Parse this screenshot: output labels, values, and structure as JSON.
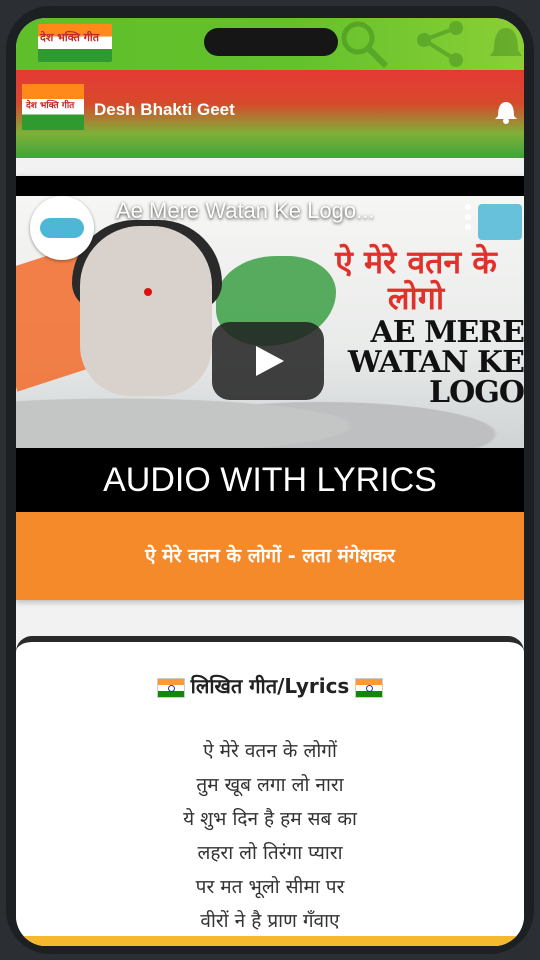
{
  "status_bar": {
    "logo_text": "देश भक्ति गीत"
  },
  "app_bar": {
    "title": "Desh Bhakti Geet",
    "logo_text": "देश भक्ति गीत"
  },
  "video": {
    "title": "Ae Mere Watan Ke Logo...",
    "thumbnail_hindi": "ऐ मेरे वतन के लोगो",
    "thumbnail_english": "AE MERE WATAN KE LOGO",
    "caption": "AUDIO WITH LYRICS"
  },
  "song_bar": {
    "label": "ऐ मेरे वतन के लोगों - लता मंगेशकर"
  },
  "lyrics": {
    "heading": "लिखित गीत/Lyrics",
    "lines": [
      "ऐ मेरे वतन के लोगों",
      "तुम खूब लगा लो नारा",
      "ये शुभ दिन है हम सब का",
      "लहरा लो तिरंगा प्यारा",
      "पर मत भूलो सीमा पर",
      "वीरों ने है प्राण गँवाए"
    ]
  },
  "colors": {
    "app_bar_top": "#e53935",
    "app_bar_bottom": "#3fa43a",
    "song_bar": "#f58a2b",
    "banner": "#f5b82e"
  }
}
